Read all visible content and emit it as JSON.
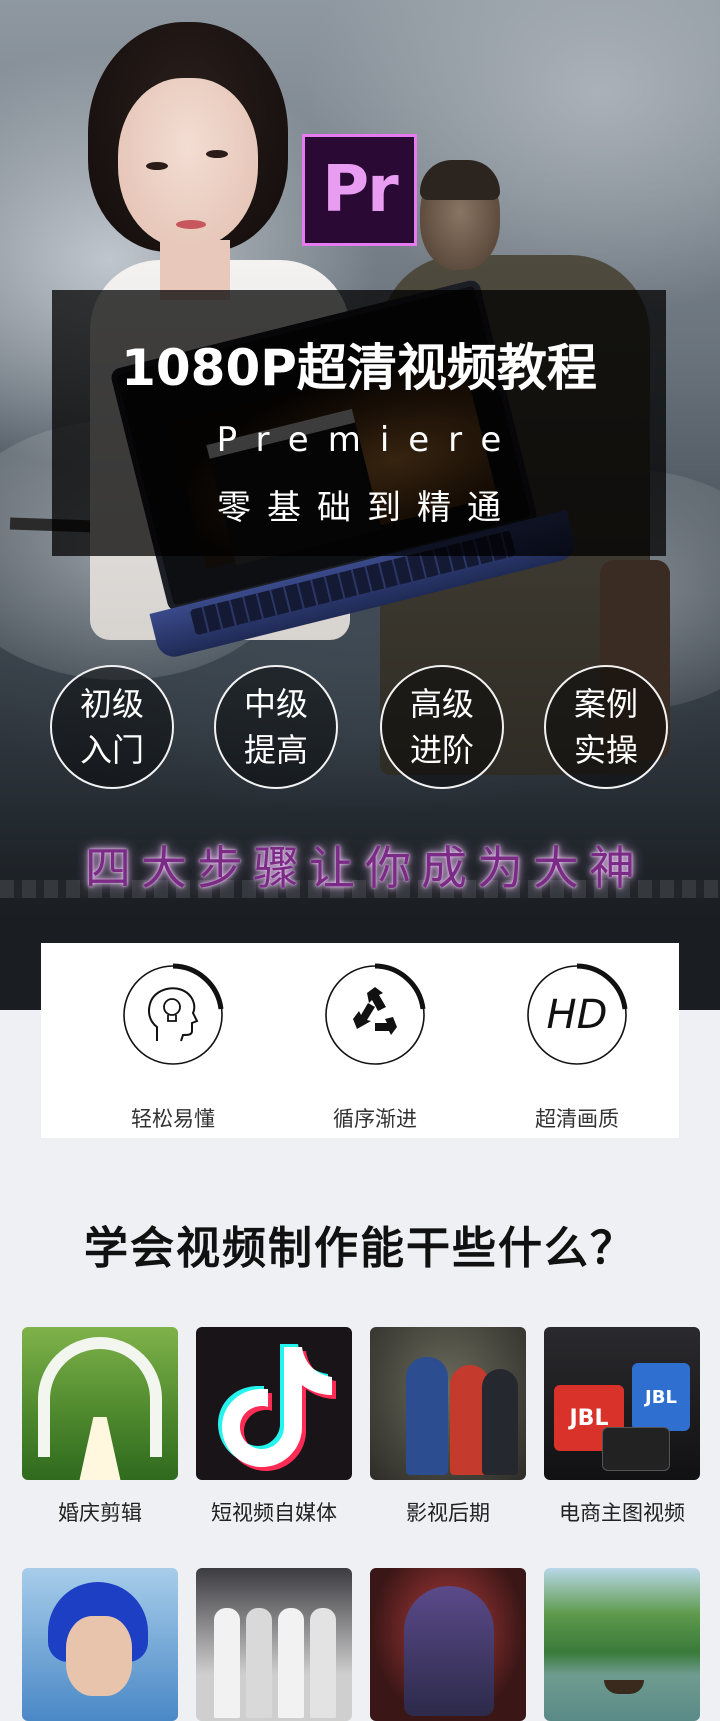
{
  "hero": {
    "logo_text": "Pr",
    "title": "1080P超清视频教程",
    "subtitle_en": "Premiere",
    "subtitle_cn": "零基础到精通",
    "levels": [
      {
        "line1": "初级",
        "line2": "入门"
      },
      {
        "line1": "中级",
        "line2": "提高"
      },
      {
        "line1": "高级",
        "line2": "进阶"
      },
      {
        "line1": "案例",
        "line2": "实操"
      }
    ],
    "slogan": "四大步骤让你成为大神"
  },
  "features": [
    {
      "icon": "head-lightbulb-icon",
      "label": "轻松易懂"
    },
    {
      "icon": "recycle-icon",
      "label": "循序渐进"
    },
    {
      "icon": "hd-icon",
      "text": "HD",
      "label": "超清画质"
    }
  ],
  "section": {
    "question": "学会视频制作能干些什么？"
  },
  "uses": [
    {
      "label": "婚庆剪辑"
    },
    {
      "label": "短视频自媒体"
    },
    {
      "label": "影视后期"
    },
    {
      "label": "电商主图视频"
    }
  ],
  "jbl_text": "JBL",
  "colors": {
    "accent_purple": "#7b2a86",
    "pr_logo_bg": "#2a0a35",
    "pr_logo_border": "#e67bf0",
    "page_bg": "#eef0f4"
  }
}
